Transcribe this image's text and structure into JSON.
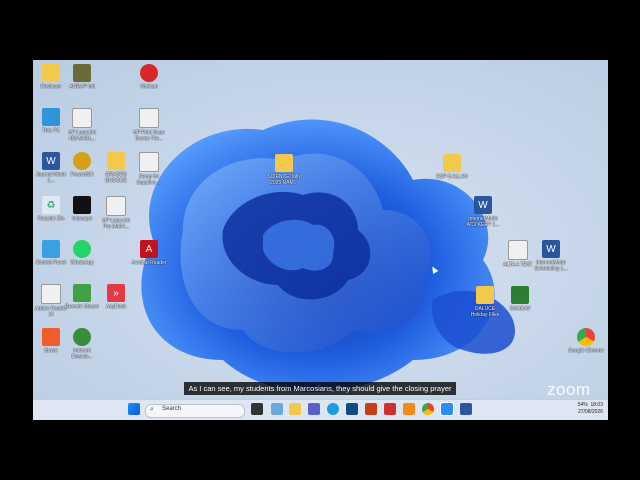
{
  "desktop": {
    "icons": [
      {
        "label": "Reviewer",
        "color": "#f2c94c"
      },
      {
        "label": "ANRAP Intl",
        "color": "#6b6b38"
      },
      {
        "label": "VinCam",
        "color": "#d62828"
      },
      {
        "label": "This PC",
        "color": "#2f95d6"
      },
      {
        "label": "HP LaserJet 400 M401...",
        "color": "#f0f0f0"
      },
      {
        "label": "HP Print Scan Doctor Fre...",
        "color": "#f0f0f0"
      },
      {
        "label": "Journal Week 1...",
        "color": "#2b579a"
      },
      {
        "label": "PowerISO",
        "color": "#d4a017"
      },
      {
        "label": "GRADES ENCODE",
        "color": "#f2c94c"
      },
      {
        "label": "Setup for Supplies ...",
        "color": "#f0f0f0"
      },
      {
        "label": "Recycle Bin",
        "color": "#e0e8f0"
      },
      {
        "label": "Inkscape",
        "color": "#111111"
      },
      {
        "label": "HP LaserJet Pro M404...",
        "color": "#f0f0f0"
      },
      {
        "label": "Control Panel",
        "color": "#3aa0e0"
      },
      {
        "label": "WhatsApp",
        "color": "#25d366"
      },
      {
        "label": "Acrobat Reader",
        "color": "#c1121f"
      },
      {
        "label": "Adobe Reader XI",
        "color": "#f0f0f0"
      },
      {
        "label": "Remote Mouse",
        "color": "#43a047"
      },
      {
        "label": "AnyDesk",
        "color": "#e63946"
      },
      {
        "label": "Brave",
        "color": "#f25c2a"
      },
      {
        "label": "Internet Downlo...",
        "color": "#3a8b3a"
      },
      {
        "label": "SCIENCE Tally 2025 RAM...",
        "color": "#f2c94c"
      },
      {
        "label": "ESP 8 ALLAN",
        "color": "#f2c94c"
      },
      {
        "label": "InternetMode AC1 KEEP 1...",
        "color": "#2b579a"
      },
      {
        "label": "ALTA A TEST",
        "color": "#f0f0f0"
      },
      {
        "label": "InternetMode Scheduling 1...",
        "color": "#2b579a"
      },
      {
        "label": "DALUCE Holiday Files",
        "color": "#f2c94c"
      },
      {
        "label": "SMADAV",
        "color": "#2e7d32"
      },
      {
        "label": "Google Chrome",
        "color": "#e0e0e0"
      }
    ]
  },
  "taskbar": {
    "search_placeholder": "Search",
    "time": "18:03",
    "date": "27/08/2026",
    "battery": "54%"
  },
  "overlay": {
    "subtitle": "As I can see, my students from Marcosians, they should give the closing prayer",
    "zoom_brand": "zoom"
  }
}
